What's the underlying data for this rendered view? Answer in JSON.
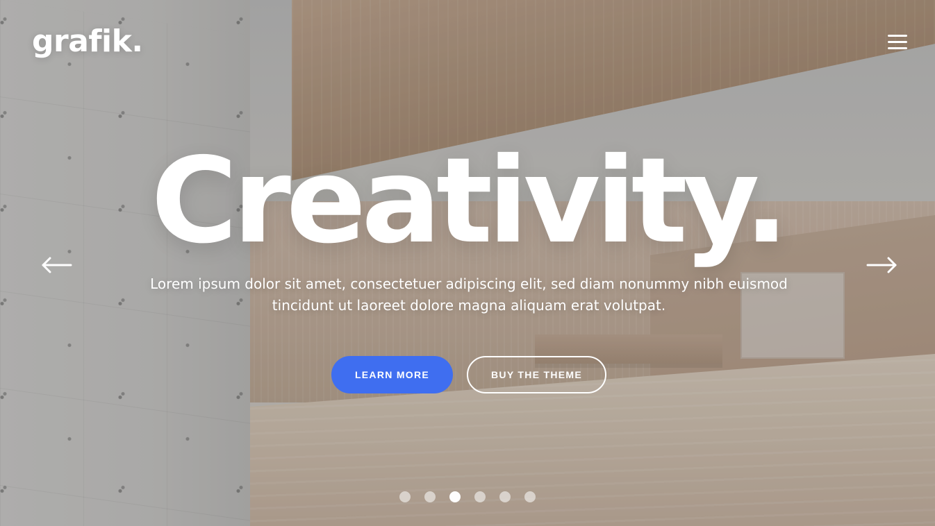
{
  "brand": {
    "logo_text": "grafik."
  },
  "header": {
    "menu_icon": "hamburger-menu-icon"
  },
  "hero": {
    "title": "Creativity.",
    "subtitle": "Lorem ipsum dolor sit amet, consectetuer adipiscing elit, sed diam nonummy nibh euismod tincidunt ut laoreet dolore magna aliquam erat volutpat."
  },
  "actions": {
    "primary_label": "LEARN MORE",
    "secondary_label": "BUY THE THEME"
  },
  "carousel": {
    "prev_icon": "arrow-left-icon",
    "next_icon": "arrow-right-icon",
    "slide_count": 6,
    "active_index": 2
  },
  "colors": {
    "accent": "#3f6ef0",
    "text": "#ffffff"
  }
}
